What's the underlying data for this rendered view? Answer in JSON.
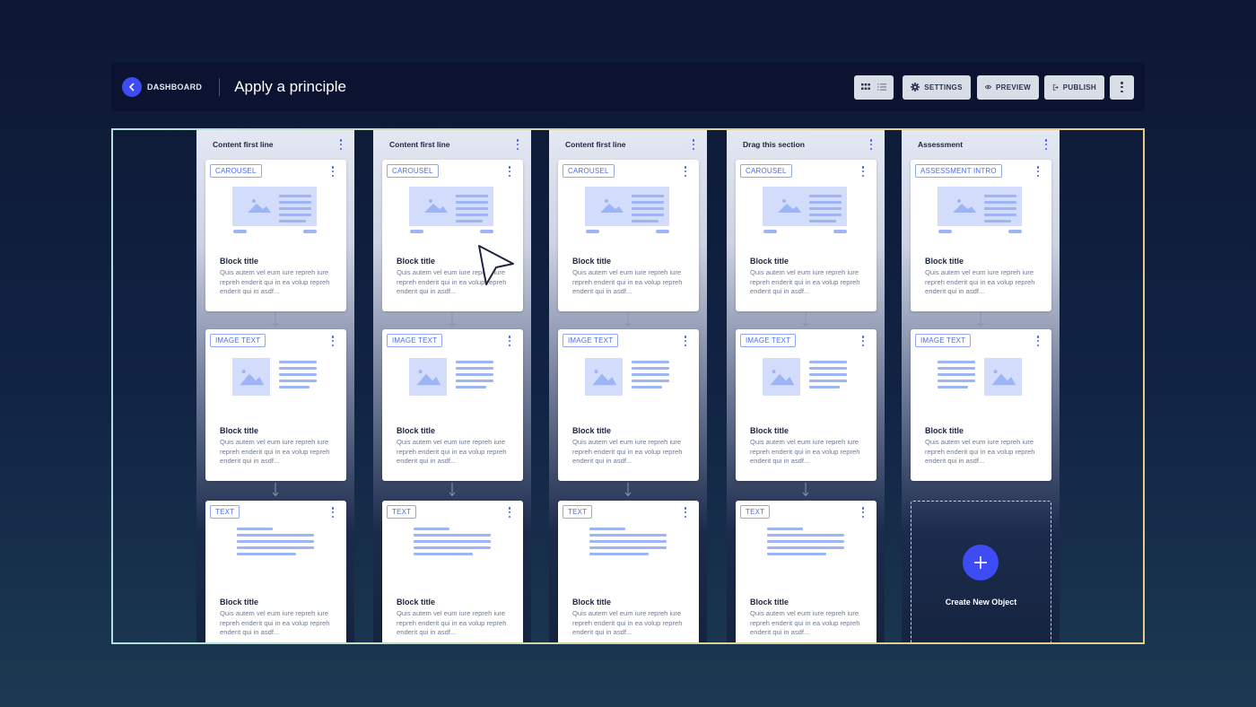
{
  "header": {
    "back_label": "DASHBOARD",
    "title": "Apply a principle",
    "settings_label": "SETTINGS",
    "preview_label": "PREVIEW",
    "publish_label": "PUBLISH"
  },
  "card_text": {
    "title": "Block title",
    "body": "Quis autem vel eum iure repreh iure repreh enderit qui in ea volup repreh enderit qui in asdf..."
  },
  "columns": [
    {
      "title": "Content first line",
      "cards": [
        "CAROUSEL",
        "IMAGE TEXT",
        "TEXT"
      ]
    },
    {
      "title": "Content first line",
      "cards": [
        "CAROUSEL",
        "IMAGE TEXT",
        "TEXT"
      ]
    },
    {
      "title": "Content first line",
      "cards": [
        "CAROUSEL",
        "IMAGE TEXT",
        "TEXT"
      ]
    },
    {
      "title": "Drag this section",
      "cards": [
        "CAROUSEL",
        "IMAGE TEXT",
        "TEXT"
      ]
    },
    {
      "title": "Assessment",
      "cards": [
        "ASSESSMENT INTRO",
        "IMAGE TEXT"
      ]
    }
  ],
  "create_label": "Create New Object",
  "colors": {
    "accent": "#3d4cf5",
    "tag": "#4a6df0",
    "illustration": "#d3ddfb",
    "illustration_line": "#9db5f5"
  },
  "icons": [
    "chevron-left-icon",
    "grid-view-icon",
    "list-view-icon",
    "gear-icon",
    "eye-icon",
    "publish-icon",
    "more-vertical-icon",
    "image-icon",
    "plus-icon",
    "cursor-icon"
  ]
}
